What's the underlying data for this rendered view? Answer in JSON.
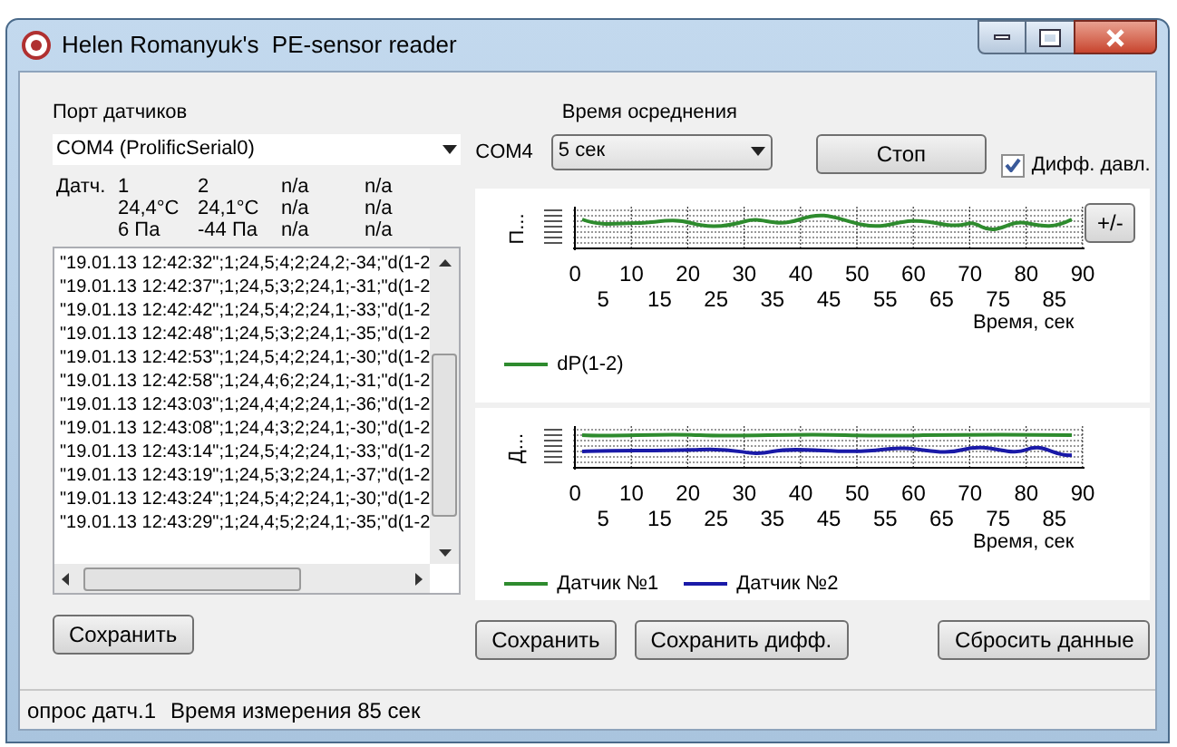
{
  "window": {
    "title": "Helen Romanyuk's  PE-sensor reader"
  },
  "port": {
    "label": "Порт датчиков",
    "value": "COM4 (ProlificSerial0)",
    "port_name": "COM4"
  },
  "averaging": {
    "label": "Время осреднения",
    "value": "5 сек"
  },
  "stop_button": "Стоп",
  "diff_pressure": {
    "label": "Дифф. давл.",
    "checked": true
  },
  "sensors": {
    "label": "Датч.",
    "rows": [
      [
        "1",
        "2",
        "n/a",
        "n/a"
      ],
      [
        "24,4°C",
        "24,1°C",
        "n/a",
        "n/a"
      ],
      [
        "6 Па",
        "-44 Па",
        "n/a",
        "n/a"
      ]
    ]
  },
  "log": [
    "\"19.01.13 12:42:32\";1;24,5;4;2;24,2;-34;\"d(1-2",
    "\"19.01.13 12:42:37\";1;24,5;3;2;24,1;-31;\"d(1-2",
    "\"19.01.13 12:42:42\";1;24,5;4;2;24,1;-33;\"d(1-2",
    "\"19.01.13 12:42:48\";1;24,5;3;2;24,1;-35;\"d(1-2",
    "\"19.01.13 12:42:53\";1;24,5;4;2;24,1;-30;\"d(1-2",
    "\"19.01.13 12:42:58\";1;24,4;6;2;24,1;-31;\"d(1-2",
    "\"19.01.13 12:43:03\";1;24,4;4;2;24,1;-36;\"d(1-2",
    "\"19.01.13 12:43:08\";1;24,4;3;2;24,1;-30;\"d(1-2",
    "\"19.01.13 12:43:14\";1;24,5;4;2;24,1;-33;\"d(1-2",
    "\"19.01.13 12:43:19\";1;24,5;3;2;24,1;-37;\"d(1-2",
    "\"19.01.13 12:43:24\";1;24,5;4;2;24,1;-30;\"d(1-2",
    "\"19.01.13 12:43:29\";1;24,4;5;2;24,1;-35;\"d(1-2"
  ],
  "charts": [
    {
      "ylabel": "П...",
      "zoom_button": "+/-",
      "ticks_upper": [
        "0",
        "10",
        "20",
        "30",
        "40",
        "50",
        "60",
        "70",
        "80",
        "90"
      ],
      "ticks_lower": [
        "5",
        "15",
        "25",
        "35",
        "45",
        "55",
        "65",
        "75",
        "85"
      ],
      "xlabel": "Время, сек",
      "legend": [
        {
          "name": "dP(1-2)",
          "color": "#2e8b2e"
        }
      ]
    },
    {
      "ylabel": "Д...",
      "ticks_upper": [
        "0",
        "10",
        "20",
        "30",
        "40",
        "50",
        "60",
        "70",
        "80",
        "90"
      ],
      "ticks_lower": [
        "5",
        "15",
        "25",
        "35",
        "45",
        "55",
        "65",
        "75",
        "85"
      ],
      "xlabel": "Время, сек",
      "legend": [
        {
          "name": "Датчик №1",
          "color": "#2e8b2e"
        },
        {
          "name": "Датчик №2",
          "color": "#1a1aa8"
        }
      ]
    }
  ],
  "buttons_left": [
    "Сохранить"
  ],
  "buttons_right": [
    {
      "label": "Сохранить",
      "kind": "save"
    },
    {
      "label": "Сохранить дифф.",
      "kind": "save_diff"
    },
    {
      "label": "Сбросить данные",
      "kind": "reset"
    }
  ],
  "status_bar": [
    "опрос датч.1",
    "Время измерения 85 сек"
  ]
}
